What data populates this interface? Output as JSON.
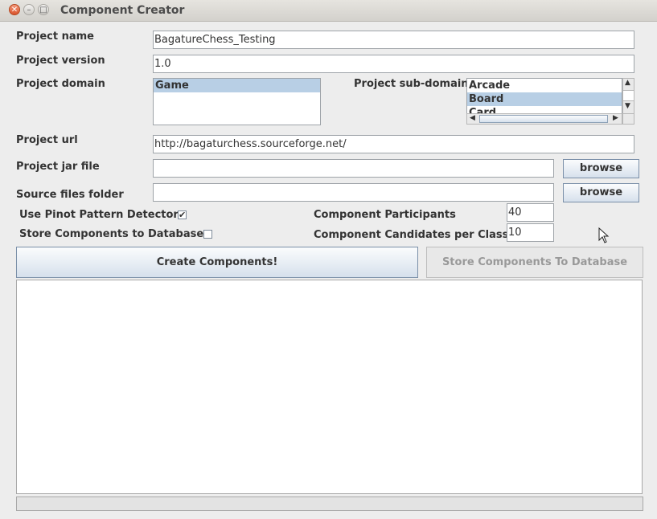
{
  "window": {
    "title": "Component Creator"
  },
  "labels": {
    "project_name": "Project name",
    "project_version": "Project version",
    "project_domain": "Project domain",
    "project_subdomain": "Project sub-domain",
    "project_url": "Project url",
    "project_jar_file": "Project jar file",
    "source_files_folder": "Source files folder",
    "use_pinot": "Use Pinot Pattern Detector",
    "store_components_db": "Store Components to Database",
    "component_participants": "Component Participants",
    "component_candidates": "Component Candidates per Class"
  },
  "fields": {
    "project_name": "BagatureChess_Testing",
    "project_version": "1.0",
    "project_url": "http://bagaturchess.sourceforge.net/",
    "project_jar_file": "",
    "source_files_folder": "",
    "component_participants": "40",
    "component_candidates": "10"
  },
  "domain_list": {
    "items": [
      "Game"
    ],
    "selected": "Game"
  },
  "subdomain_list": {
    "items": [
      "Arcade",
      "Board",
      "Card"
    ],
    "selected": "Board"
  },
  "checkboxes": {
    "use_pinot": true,
    "store_components_db": false
  },
  "buttons": {
    "browse_jar": "browse",
    "browse_source": "browse",
    "create_components": "Create Components!",
    "store_components": "Store Components To Database"
  },
  "icons": {
    "close": "close-icon",
    "minimize": "minimize-icon",
    "maximize": "maximize-icon",
    "check": "checkmark-icon"
  }
}
